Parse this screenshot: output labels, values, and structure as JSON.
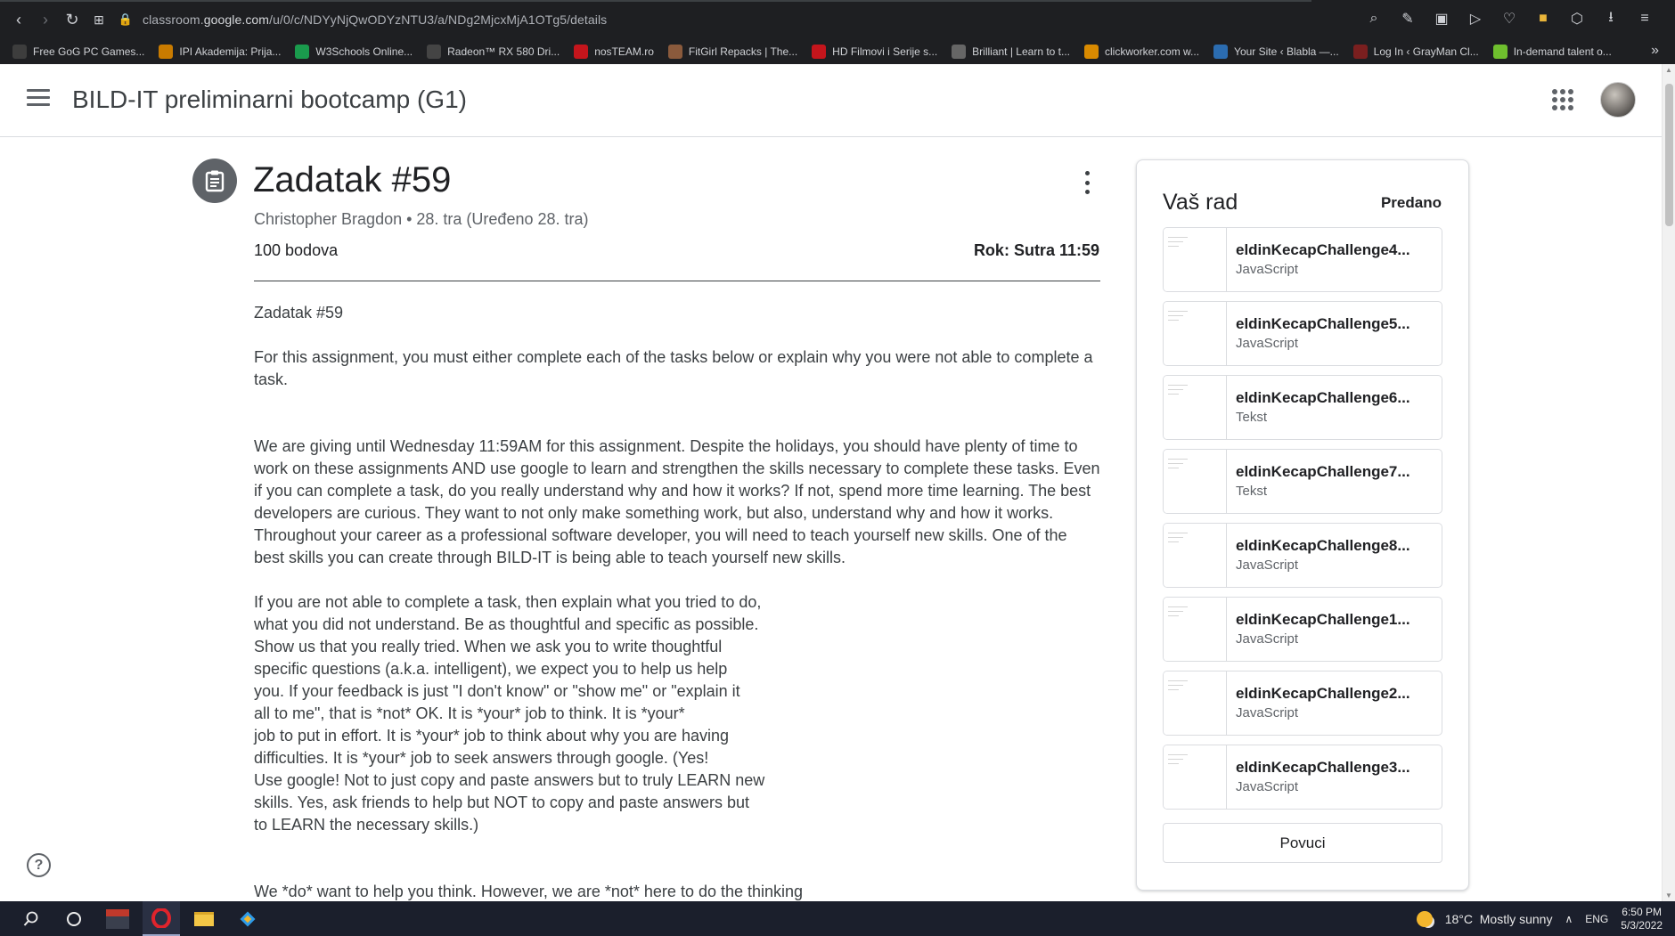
{
  "browser": {
    "url_prefix": "classroom.",
    "url_host": "google.com",
    "url_path": "/u/0/c/NDYyNjQwODYzNTU3/a/NDg2MjcxMjA1OTg5/details",
    "bookmarks": [
      {
        "label": "Free GoG PC Games...",
        "color": "#3d3d3d"
      },
      {
        "label": "IPI Akademija: Prija...",
        "color": "#c97b00"
      },
      {
        "label": "W3Schools Online...",
        "color": "#1a9b4d"
      },
      {
        "label": "Radeon™ RX 580 Dri...",
        "color": "#444"
      },
      {
        "label": "nosTEAM.ro",
        "color": "#c4151c"
      },
      {
        "label": "FitGirl Repacks | The...",
        "color": "#8a5a3c"
      },
      {
        "label": "HD Filmovi i Serije s...",
        "color": "#c4151c"
      },
      {
        "label": "Brilliant | Learn to t...",
        "color": "#666"
      },
      {
        "label": "clickworker.com w...",
        "color": "#d98a00"
      },
      {
        "label": "Your Site ‹ Blabla —...",
        "color": "#2b6cb0"
      },
      {
        "label": "Log In ‹ GrayMan Cl...",
        "color": "#7a1f1f"
      },
      {
        "label": "In-demand talent o...",
        "color": "#6fbf2e"
      }
    ]
  },
  "header": {
    "course_title": "BILD-IT preliminarni bootcamp (G1)"
  },
  "assignment": {
    "title": "Zadatak #59",
    "meta": "Christopher Bragdon • 28. tra (Uređeno 28. tra)",
    "points": "100 bodova",
    "due": "Rok: Sutra 11:59",
    "paragraphs": [
      "Zadatak #59",
      "For this assignment, you must either complete each of the tasks below or explain why you were not able to complete a task.",
      "We are giving until Wednesday 11:59AM for this assignment. Despite the holidays, you should have plenty of time to work on these assignments AND use google to learn and strengthen the skills necessary to complete these tasks. Even if you can complete a task, do you really understand why and how it works? If not, spend more time learning. The best developers are curious. They want to not only make something work, but also, understand why and how it works. Throughout your career as a professional software developer, you will need to teach yourself new skills. One of the best skills you can create through BILD-IT is being able to teach yourself new skills.",
      "If you are not able to complete a task, then explain what you tried to do,\nwhat you did not understand. Be as thoughtful and specific as possible.\nShow us that you really tried. When we ask you to write thoughtful\nspecific questions (a.k.a. intelligent), we expect you to help us help\nyou. If your feedback is just \"I don't know\" or \"show me\" or \"explain it\nall to me\", that is *not* OK. It is *your* job to think. It is *your*\njob to put in effort. It is *your* job to think about why you are having\ndifficulties. It is *your* job to seek answers through google. (Yes!\nUse google! Not to just copy and paste answers but to truly LEARN new\nskills. Yes, ask friends to help but NOT to copy and paste answers but\nto LEARN the necessary skills.)",
      "We *do* want to help you think. However, we are *not* here to do the thinking"
    ]
  },
  "work": {
    "title": "Vaš rad",
    "status": "Predano",
    "attachments": [
      {
        "name": "eldinKecapChallenge4...",
        "type": "JavaScript"
      },
      {
        "name": "eldinKecapChallenge5...",
        "type": "JavaScript"
      },
      {
        "name": "eldinKecapChallenge6...",
        "type": "Tekst"
      },
      {
        "name": "eldinKecapChallenge7...",
        "type": "Tekst"
      },
      {
        "name": "eldinKecapChallenge8...",
        "type": "JavaScript"
      },
      {
        "name": "eldinKecapChallenge1...",
        "type": "JavaScript"
      },
      {
        "name": "eldinKecapChallenge2...",
        "type": "JavaScript"
      },
      {
        "name": "eldinKecapChallenge3...",
        "type": "JavaScript"
      }
    ],
    "unsubmit_label": "Povuci"
  },
  "taskbar": {
    "weather": "18°C  Mostly sunny",
    "language": "ENG",
    "time": "6:50 PM",
    "date": "5/3/2022"
  }
}
